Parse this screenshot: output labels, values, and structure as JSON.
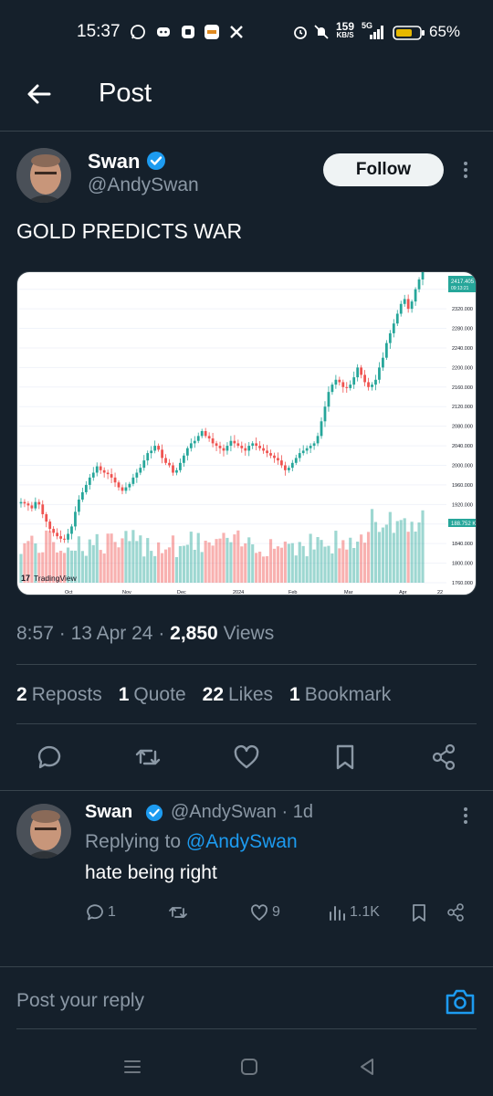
{
  "status_bar": {
    "time": "15:37",
    "net_speed": "159",
    "net_unit": "KB/S",
    "net_type": "5G",
    "battery_percent": "65%"
  },
  "header": {
    "title": "Post"
  },
  "post": {
    "author_name": "Swan",
    "author_handle": "@AndySwan",
    "follow_label": "Follow",
    "text": "GOLD PREDICTS WAR",
    "time": "8:57",
    "date": "13 Apr 24",
    "views_count": "2,850",
    "views_label": "Views",
    "sep": "·"
  },
  "stats": {
    "reposts_count": "2",
    "reposts_label": "Reposts",
    "quotes_count": "1",
    "quotes_label": "Quote",
    "likes_count": "22",
    "likes_label": "Likes",
    "bookmarks_count": "1",
    "bookmarks_label": "Bookmark"
  },
  "reply": {
    "author_name": "Swan",
    "handle_time": "@AndySwan · 1d",
    "replying_prefix": "Replying to",
    "replying_handle": "@AndySwan",
    "text": "hate being right",
    "replies": "1",
    "likes": "9",
    "views": "1.1K"
  },
  "composer": {
    "placeholder": "Post your reply"
  },
  "colors": {
    "accent": "#1d9bf0",
    "background": "#15202b",
    "up": "#26a69a",
    "down": "#ef5350"
  },
  "chart_data": {
    "type": "candlestick",
    "brand": "TradingView",
    "x_ticks": [
      "Oct",
      "Nov",
      "Dec",
      "2024",
      "Feb",
      "Mar",
      "Apr",
      "22"
    ],
    "y_ticks": [
      2360,
      2320,
      2280,
      2240,
      2200,
      2160,
      2120,
      2080,
      2040,
      2000,
      1960,
      1920,
      1880,
      1840,
      1800,
      1760
    ],
    "ylim": [
      1760,
      2380
    ],
    "last_price": "2417.405",
    "last_price_time": "09:13:21",
    "volume_label": "188.752 K",
    "close_series": [
      1925,
      1922,
      1918,
      1912,
      1925,
      1920,
      1900,
      1885,
      1870,
      1862,
      1855,
      1850,
      1848,
      1860,
      1875,
      1905,
      1930,
      1945,
      1960,
      1975,
      1985,
      1998,
      1990,
      1985,
      1982,
      1975,
      1965,
      1955,
      1948,
      1955,
      1962,
      1975,
      1985,
      1995,
      2010,
      2025,
      2030,
      2040,
      2032,
      2015,
      2005,
      2000,
      1985,
      1990,
      2005,
      2020,
      2035,
      2045,
      2050,
      2060,
      2070,
      2060,
      2055,
      2045,
      2040,
      2035,
      2030,
      2040,
      2050,
      2045,
      2040,
      2035,
      2030,
      2040,
      2045,
      2040,
      2035,
      2030,
      2025,
      2020,
      2015,
      2010,
      2000,
      1990,
      1995,
      2005,
      2015,
      2025,
      2030,
      2035,
      2040,
      2045,
      2060,
      2090,
      2120,
      2150,
      2165,
      2175,
      2170,
      2160,
      2158,
      2165,
      2180,
      2200,
      2185,
      2170,
      2160,
      2165,
      2175,
      2200,
      2220,
      2250,
      2270,
      2290,
      2310,
      2330,
      2340,
      2320,
      2335,
      2360,
      2380,
      2400
    ]
  }
}
